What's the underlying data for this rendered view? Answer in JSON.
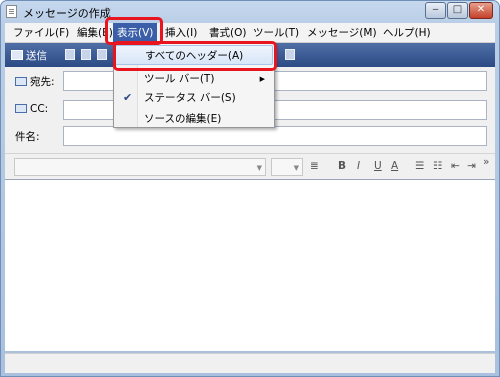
{
  "window": {
    "title": "メッセージの作成",
    "controls": {
      "minimize": "‒",
      "maximize": "□",
      "close": "✕"
    }
  },
  "menubar": {
    "items": [
      {
        "label": "ファイル(F)"
      },
      {
        "label": "編集(E)"
      },
      {
        "label": "表示(V)"
      },
      {
        "label": "挿入(I)"
      },
      {
        "label": "書式(O)"
      },
      {
        "label": "ツール(T)"
      },
      {
        "label": "メッセージ(M)"
      },
      {
        "label": "ヘルプ(H)"
      }
    ]
  },
  "toolbar": {
    "send_label": "送信"
  },
  "headers": {
    "to_label": "宛先:",
    "cc_label": "CC:",
    "subject_label": "件名:",
    "to_value": "",
    "cc_value": "",
    "subject_value": ""
  },
  "view_menu": {
    "items": [
      {
        "label": "すべてのヘッダー(A)"
      },
      {
        "label": "ツール バー(T)"
      },
      {
        "label": "ステータス バー(S)",
        "checked": true
      },
      {
        "label": "ソースの編集(E)"
      }
    ]
  },
  "formatting": {
    "bold": "B",
    "italic": "I",
    "underline": "U",
    "font_color": "A"
  },
  "colors": {
    "accent": "#3a5fa8",
    "highlight_box": "#e8141e",
    "toolbar": "#2c4a85"
  }
}
